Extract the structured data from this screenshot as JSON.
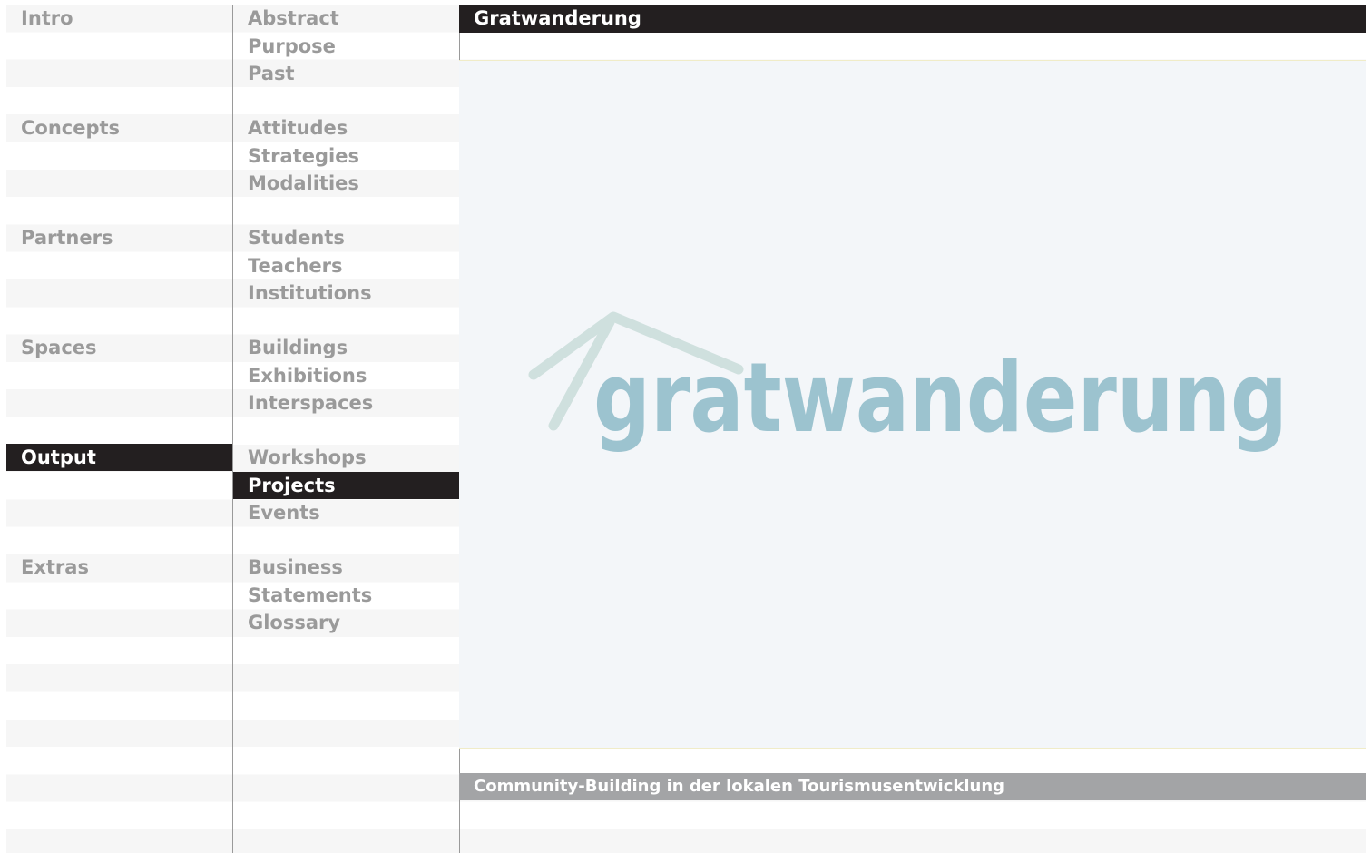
{
  "nav": {
    "sections": [
      {
        "label": "Intro",
        "items": [
          "Abstract",
          "Purpose",
          "Past"
        ]
      },
      {
        "label": "Concepts",
        "items": [
          "Attitudes",
          "Strategies",
          "Modalities"
        ]
      },
      {
        "label": "Partners",
        "items": [
          "Students",
          "Teachers",
          "Institutions"
        ]
      },
      {
        "label": "Spaces",
        "items": [
          "Buildings",
          "Exhibitions",
          "Interspaces"
        ]
      },
      {
        "label": "Output",
        "items": [
          "Workshops",
          "Projects",
          "Events"
        ]
      },
      {
        "label": "Extras",
        "items": [
          "Business",
          "Statements",
          "Glossary"
        ]
      }
    ],
    "active_section": "Output",
    "active_item": "Projects"
  },
  "main": {
    "title": "Gratwanderung",
    "logo_text": "gratwanderung",
    "caption": "Community-Building in der lokalen Tourismusentwicklung"
  },
  "colors": {
    "active_bg": "#231f20",
    "nav_text": "#9a9a9a",
    "caption_bg": "#a3a4a6",
    "logo_text": "#9cc3cf",
    "logo_roof": "#cfe0de",
    "image_bg": "#f3f6f9"
  }
}
